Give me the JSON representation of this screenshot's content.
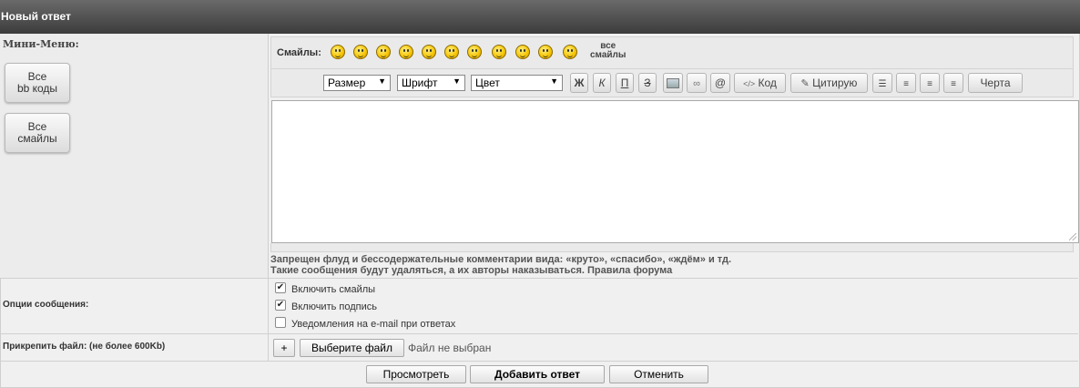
{
  "header": {
    "title": "Новый ответ"
  },
  "mini_menu": {
    "title": "Мини-Меню:",
    "buttons": [
      "Все\nbb коды",
      "Все\nсмайлы"
    ]
  },
  "smiles": {
    "label": "Смайлы:",
    "all_label": "все\nсмайлы",
    "icons": [
      "angry-smiley-icon",
      "grin-smiley-icon",
      "cool-smiley-icon",
      "crazy-smiley-icon",
      "smile-smiley-icon",
      "sad-smiley-icon",
      "happy-smiley-icon",
      "surprised-smiley-icon",
      "tongue-smiley-icon",
      "confused-smiley-icon",
      "laugh-smiley-icon"
    ]
  },
  "toolbar": {
    "size_select": "Размер",
    "font_select": "Шрифт",
    "color_select": "Цвет",
    "bold": "Ж",
    "italic": "К",
    "underline": "П",
    "strike": "З",
    "code": "Код",
    "quote": "Цитирую",
    "at": "@",
    "line": "Черта"
  },
  "message": {
    "value": ""
  },
  "rules": {
    "line1": "Запрещен флуд и бессодержательные комментарии вида: «круто», «спасибо», «ждём» и тд.",
    "line2": "Такие сообщения будут удаляться, а их авторы наказываться. Правила форума"
  },
  "options": {
    "label": "Опции сообщения:",
    "items": [
      {
        "label": "Включить смайлы",
        "checked": true
      },
      {
        "label": "Включить подпись",
        "checked": true
      },
      {
        "label": "Уведомления на e-mail при ответах",
        "checked": false
      }
    ]
  },
  "attach": {
    "label": "Прикрепить файл: (не более 600Kb)",
    "plus": "+",
    "choose": "Выберите файл",
    "status": "Файл не выбран"
  },
  "actions": {
    "preview": "Просмотреть",
    "submit": "Добавить ответ",
    "cancel": "Отменить"
  },
  "colors": {
    "header_dark": "#3c3c3c",
    "panel": "#eaeaea",
    "background": "#f0f0f0"
  }
}
